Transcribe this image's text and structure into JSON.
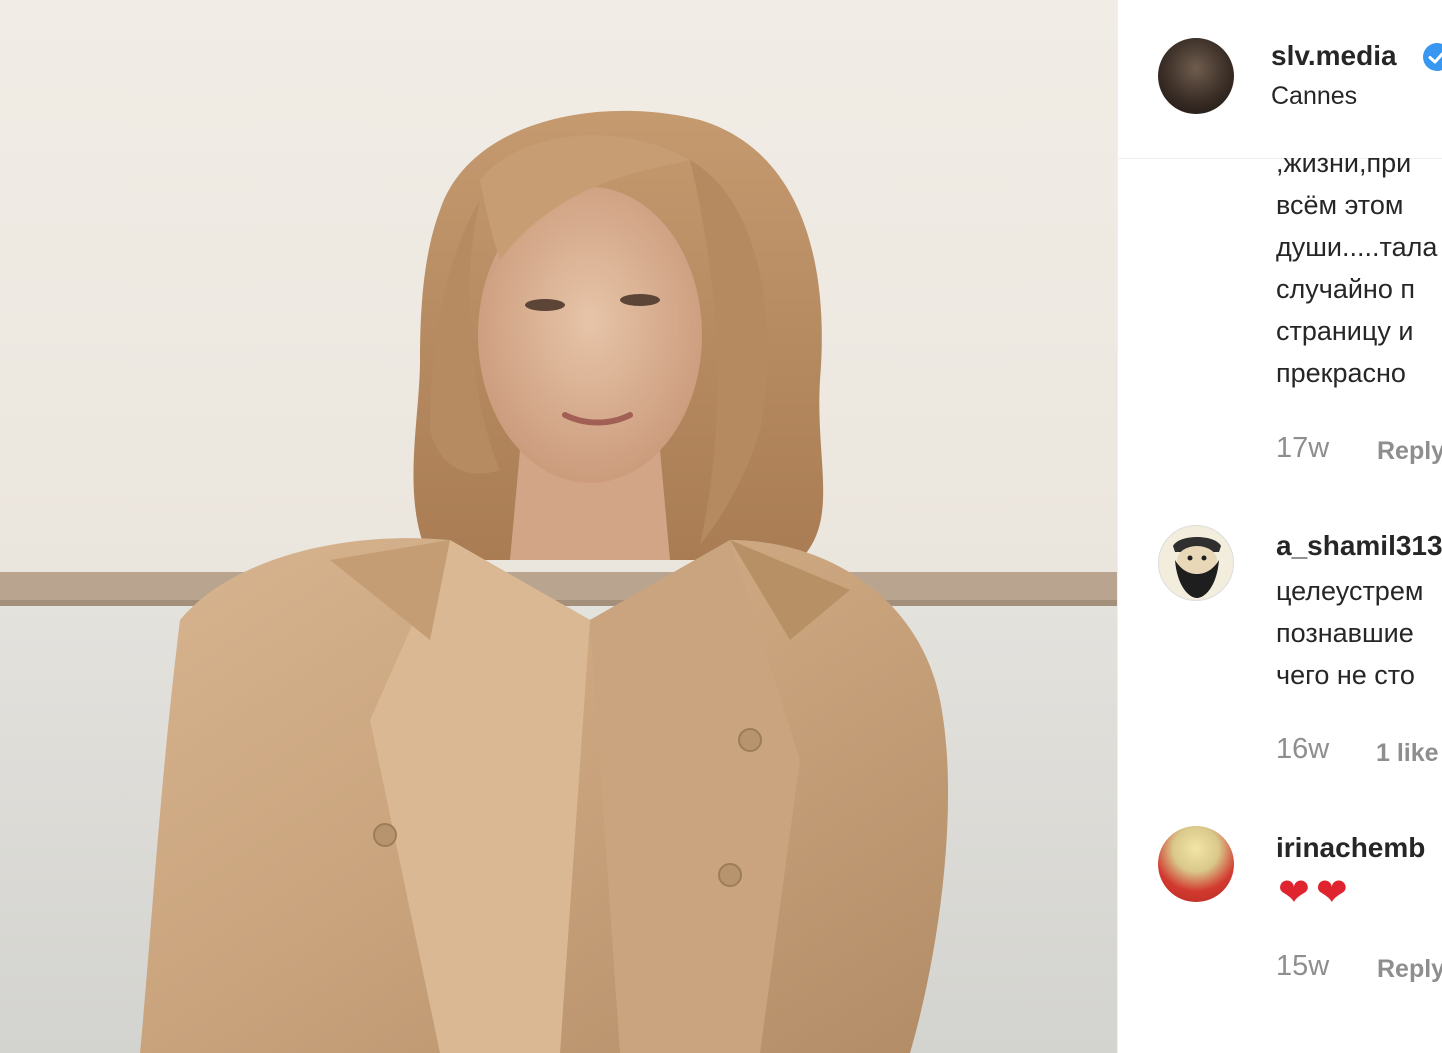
{
  "post": {
    "username": "slv.media",
    "location": "Cannes",
    "verified": true
  },
  "comments": [
    {
      "lines": [
        ",жизни,при",
        "всём этом",
        "души.....тала",
        "случайно п",
        "страницу и",
        "прекрасно"
      ],
      "age": "17w",
      "action": "Reply"
    },
    {
      "user": "a_shamil313",
      "lines": [
        "целеустрем",
        "познавшие",
        "чего не сто"
      ],
      "age": "16w",
      "likes": "1 like"
    },
    {
      "user": "irinachemb",
      "text": "❤❤",
      "age": "15w",
      "action": "Reply"
    }
  ],
  "colors": {
    "text": "#262626",
    "muted": "#8e8e8e",
    "verified": "#3897f0",
    "heart": "#e0242f"
  }
}
